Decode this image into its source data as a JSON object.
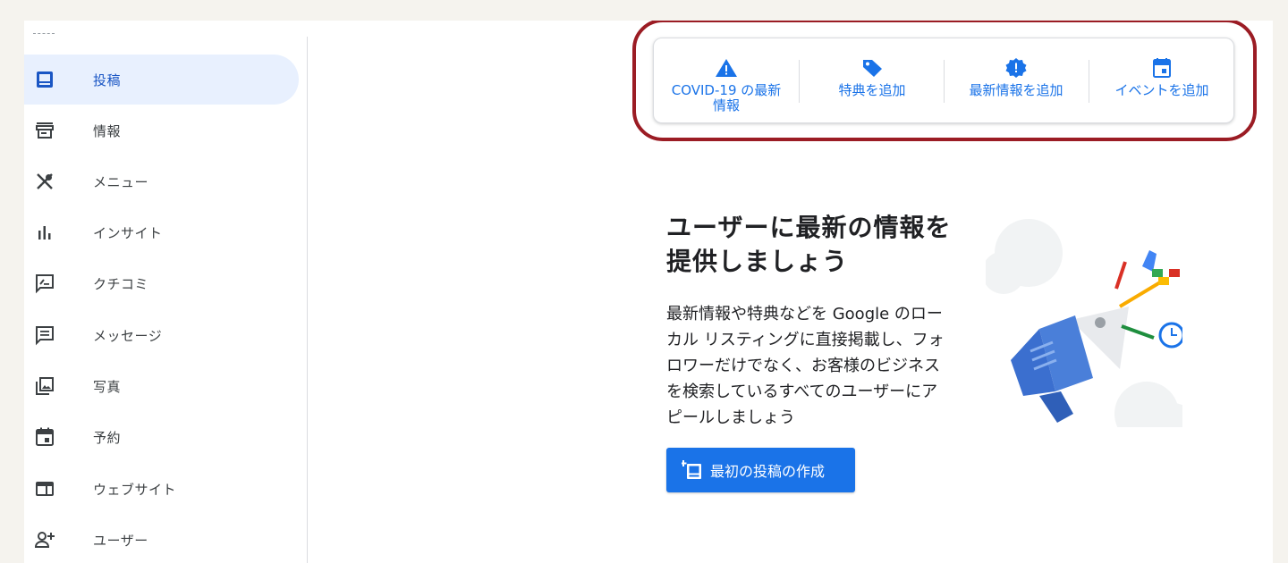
{
  "sidebar": {
    "items": [
      {
        "label": "投稿",
        "icon": "post-icon",
        "active": true
      },
      {
        "label": "情報",
        "icon": "storefront-icon",
        "active": false
      },
      {
        "label": "メニュー",
        "icon": "utensils-icon",
        "active": false
      },
      {
        "label": "インサイト",
        "icon": "bar-chart-icon",
        "active": false
      },
      {
        "label": "クチコミ",
        "icon": "review-icon",
        "active": false
      },
      {
        "label": "メッセージ",
        "icon": "message-icon",
        "active": false
      },
      {
        "label": "写真",
        "icon": "photo-icon",
        "active": false
      },
      {
        "label": "予約",
        "icon": "calendar-icon",
        "active": false
      },
      {
        "label": "ウェブサイト",
        "icon": "website-icon",
        "active": false
      },
      {
        "label": "ユーザー",
        "icon": "add-user-icon",
        "active": false
      }
    ]
  },
  "actions": [
    {
      "label": "COVID-19 の最新\n情報",
      "icon": "warning-icon"
    },
    {
      "label": "特典を追加",
      "icon": "tag-icon"
    },
    {
      "label": "最新情報を追加",
      "icon": "alert-badge-icon"
    },
    {
      "label": "イベントを追加",
      "icon": "event-icon"
    }
  ],
  "promo": {
    "headline": "ユーザーに最新の情報を提供しましょう",
    "body": "最新情報や特典などを Google のローカル リスティングに直接掲載し、フォロワーだけでなく、お客様のビジネスを検索しているすべてのユーザーにアピールしましょう",
    "button_label": "最初の投稿の作成",
    "button_icon": "add-post-icon",
    "illustration": "megaphone-illustration"
  },
  "colors": {
    "accent": "#1a73e8",
    "active_bg": "#e8f0fe",
    "highlight_ring": "#9b1c24"
  }
}
